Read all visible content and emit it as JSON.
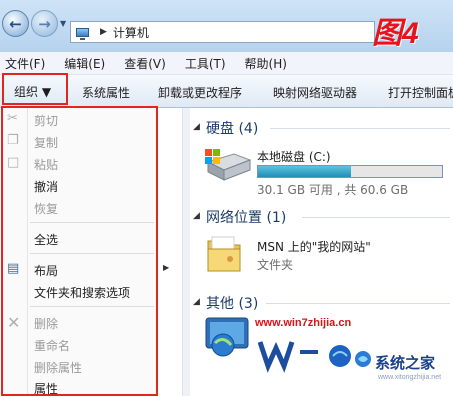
{
  "window": {
    "address_segment": "计算机",
    "watermark_label": "图4"
  },
  "menubar": {
    "items": [
      "文件(F)",
      "编辑(E)",
      "查看(V)",
      "工具(T)",
      "帮助(H)"
    ]
  },
  "toolbar": {
    "organize": "组织 ▼",
    "system_properties": "系统属性",
    "uninstall": "卸载或更改程序",
    "map_drive": "映射网络驱动器",
    "control_panel": "打开控制面板"
  },
  "organize_menu": {
    "cut": "剪切",
    "copy": "复制",
    "paste": "粘贴",
    "undo": "撤消",
    "redo": "恢复",
    "select_all": "全选",
    "layout": "布局",
    "folder_options": "文件夹和搜索选项",
    "delete": "删除",
    "rename": "重命名",
    "remove_properties": "删除属性",
    "properties": "属性"
  },
  "content": {
    "hard_disk_header": "硬盘 (4)",
    "drive_name": "本地磁盘 (C:)",
    "drive_free_text": "30.1 GB 可用 , 共 60.6 GB",
    "drive_used_fraction": 0.503,
    "network_header": "网络位置 (1)",
    "network_item_name": "MSN 上的\"我的网站\"",
    "network_item_type": "文件夹",
    "other_header": "其他 (3)"
  },
  "watermarks": {
    "site_url": "www.win7zhijia.cn",
    "brand": "系统之家",
    "brand_url": "www.xitongzhijia.net"
  },
  "colors": {
    "highlight_border": "#e0261f",
    "drive_fill": "#1f8fb6",
    "watermark_red": "#e8141b"
  }
}
